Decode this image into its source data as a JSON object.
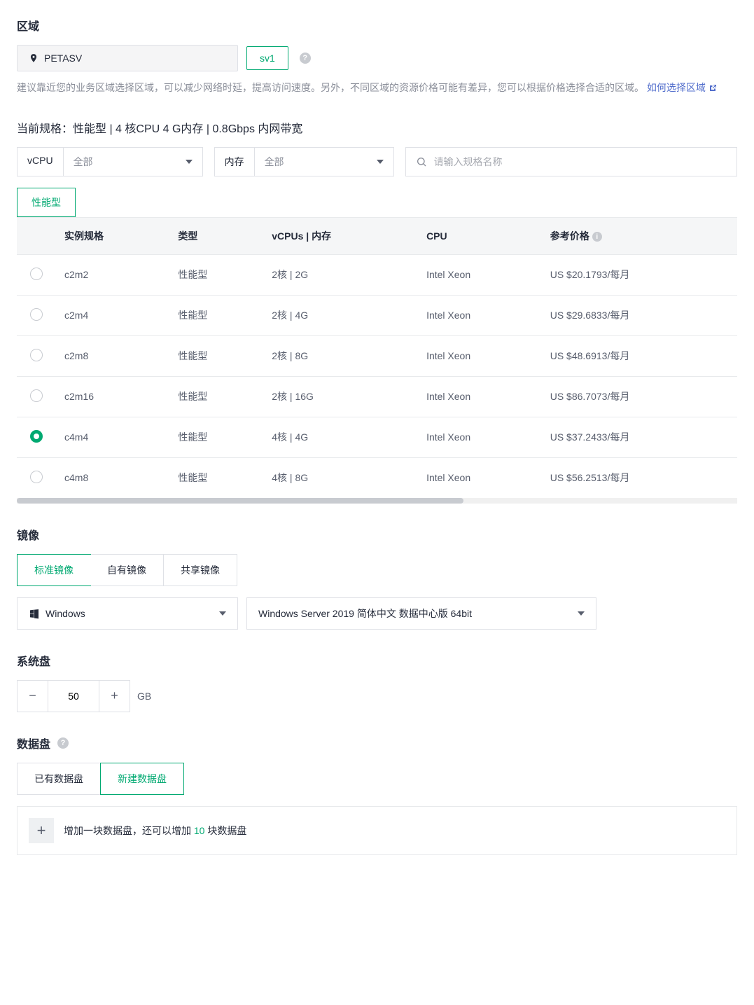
{
  "region": {
    "title": "区域",
    "selected": "PETASV",
    "zone": "sv1",
    "hint": "建议靠近您的业务区域选择区域，可以减少网络时延，提高访问速度。另外，不同区域的资源价格可能有差异，您可以根据价格选择合适的区域。 ",
    "link": "如何选择区域"
  },
  "spec": {
    "header": "当前规格：性能型 | 4 核CPU 4 G内存 | 0.8Gbps 内网带宽",
    "filters": {
      "vcpu_label": "vCPU",
      "vcpu_value": "全部",
      "mem_label": "内存",
      "mem_value": "全部",
      "search_placeholder": "请输入规格名称"
    },
    "type_tab": "性能型",
    "columns": {
      "name": "实例规格",
      "type": "类型",
      "vcpu_mem": "vCPUs | 内存",
      "cpu": "CPU",
      "price": "参考价格"
    },
    "rows": [
      {
        "name": "c2m2",
        "type": "性能型",
        "vcpu": "2核 | 2G",
        "cpu": "Intel Xeon",
        "price": "US $20.1793/每月",
        "selected": false
      },
      {
        "name": "c2m4",
        "type": "性能型",
        "vcpu": "2核 | 4G",
        "cpu": "Intel Xeon",
        "price": "US $29.6833/每月",
        "selected": false
      },
      {
        "name": "c2m8",
        "type": "性能型",
        "vcpu": "2核 | 8G",
        "cpu": "Intel Xeon",
        "price": "US $48.6913/每月",
        "selected": false
      },
      {
        "name": "c2m16",
        "type": "性能型",
        "vcpu": "2核 | 16G",
        "cpu": "Intel Xeon",
        "price": "US $86.7073/每月",
        "selected": false
      },
      {
        "name": "c4m4",
        "type": "性能型",
        "vcpu": "4核 | 4G",
        "cpu": "Intel Xeon",
        "price": "US $37.2433/每月",
        "selected": true
      },
      {
        "name": "c4m8",
        "type": "性能型",
        "vcpu": "4核 | 8G",
        "cpu": "Intel Xeon",
        "price": "US $56.2513/每月",
        "selected": false
      }
    ]
  },
  "image": {
    "title": "镜像",
    "tabs": [
      "标准镜像",
      "自有镜像",
      "共享镜像"
    ],
    "active_tab": 0,
    "os": "Windows",
    "version": "Windows Server 2019 简体中文 数据中心版 64bit"
  },
  "system_disk": {
    "title": "系统盘",
    "value": "50",
    "unit": "GB"
  },
  "data_disk": {
    "title": "数据盘",
    "tabs": [
      "已有数据盘",
      "新建数据盘"
    ],
    "active_tab": 1,
    "add_prefix": "增加一块数据盘，还可以增加 ",
    "add_count": "10",
    "add_suffix": " 块数据盘"
  }
}
